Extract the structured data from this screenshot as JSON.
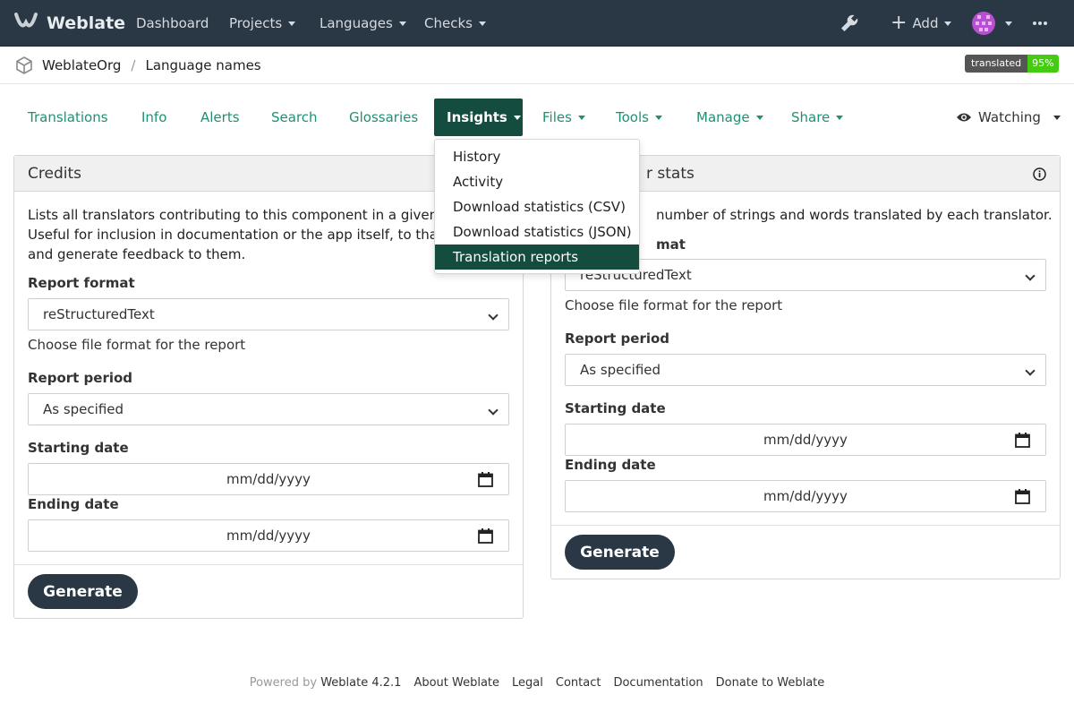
{
  "navbar": {
    "brand": "Weblate",
    "links": [
      "Dashboard",
      "Projects",
      "Languages",
      "Checks"
    ],
    "add_label": "Add",
    "icons": [
      "weblate-logo-icon",
      "wrench-icon",
      "plus-icon",
      "avatar",
      "more-icon"
    ]
  },
  "breadcrumb": {
    "project": "WeblateOrg",
    "component": "Language names",
    "icon": "cube-icon"
  },
  "badge": {
    "label": "translated",
    "value": "95%",
    "colors": {
      "label": "#555555",
      "value": "#44cc11"
    }
  },
  "tabs": [
    "Translations",
    "Info",
    "Alerts",
    "Search",
    "Glossaries",
    "Insights",
    "Files",
    "Tools",
    "Manage",
    "Share"
  ],
  "active_tab": "Insights",
  "watching": "Watching",
  "insights_menu": {
    "items": [
      "History",
      "Activity",
      "Download statistics (CSV)",
      "Download statistics (JSON)",
      "Translation reports"
    ],
    "selected": "Translation reports"
  },
  "credits": {
    "title": "Credits",
    "desc1": "Lists all translators contributing to this component in a given tim",
    "desc2": "Useful for inclusion in documentation or the app itself, to thank tr",
    "desc3": "and generate feedback to them.",
    "format_label": "Report format",
    "format_value": "reStructuredText",
    "format_help": "Choose file format for the report",
    "period_label": "Report period",
    "period_value": "As specified",
    "start_label": "Starting date",
    "start_value": "mm/dd/yyyy",
    "end_label": "Ending date",
    "end_value": "mm/dd/yyyy",
    "generate": "Generate"
  },
  "stats": {
    "title": "r stats",
    "desc": "number of strings and words translated by each translator.",
    "format_label_partial": "mat",
    "format_value": "reStructuredText",
    "format_help": "Choose file format for the report",
    "period_label": "Report period",
    "period_value": "As specified",
    "start_label": "Starting date",
    "start_value": "mm/dd/yyyy",
    "end_label": "Ending date",
    "end_value": "mm/dd/yyyy",
    "generate": "Generate"
  },
  "footer": {
    "powered_by": "Powered by",
    "version": "Weblate 4.2.1",
    "links": [
      "About Weblate",
      "Legal",
      "Contact",
      "Documentation",
      "Donate to Weblate"
    ]
  },
  "colors": {
    "navbar": "#2a3744",
    "accent": "#1f9172",
    "active": "#144d3f"
  }
}
